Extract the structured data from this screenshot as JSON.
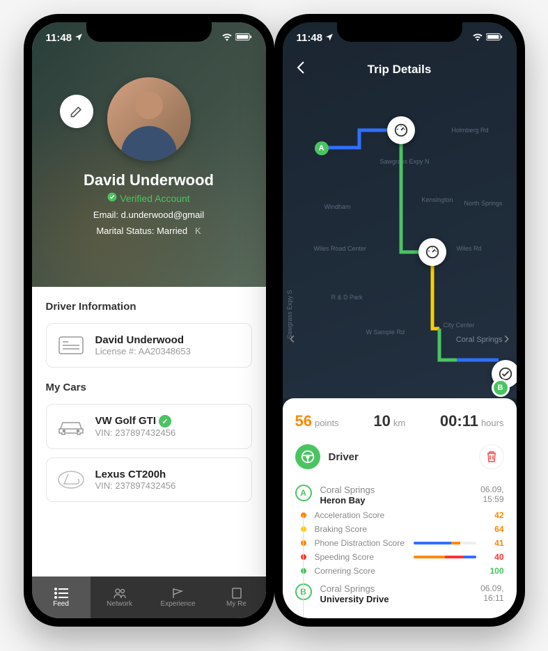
{
  "status": {
    "time": "11:48"
  },
  "phone1": {
    "profile": {
      "name": "David Underwood",
      "verified_label": "Verified Account",
      "email_label": "Email:",
      "email": "d.underwood@gmail",
      "marital_label": "Marital Status:",
      "marital": "Married"
    },
    "driver_info": {
      "section_title": "Driver Information",
      "name": "David Underwood",
      "license_label": "License #:",
      "license": "AA20348653"
    },
    "cars": {
      "section_title": "My Cars",
      "items": [
        {
          "name": "VW Golf GTI",
          "vin_label": "VIN:",
          "vin": "237897432456",
          "verified": true
        },
        {
          "name": "Lexus CT200h",
          "vin_label": "VIN:",
          "vin": "237897432456",
          "verified": false
        }
      ]
    },
    "nav": {
      "items": [
        {
          "label": "Feed"
        },
        {
          "label": "Network"
        },
        {
          "label": "Experience"
        },
        {
          "label": "My Re"
        }
      ]
    }
  },
  "phone2": {
    "title": "Trip Details",
    "stats": {
      "points_val": "56",
      "points_unit": "points",
      "dist_val": "10",
      "dist_unit": "km",
      "time_val": "00:11",
      "time_unit": "hours"
    },
    "driver_label": "Driver",
    "start": {
      "marker": "A",
      "city": "Coral Springs",
      "place": "Heron Bay",
      "date": "06.09,",
      "time": "15:59"
    },
    "end": {
      "marker": "B",
      "city": "Coral Springs",
      "place": "University Drive",
      "date": "06.09,",
      "time": "16:11"
    },
    "scores": [
      {
        "name": "Acceleration Score",
        "value": "42",
        "color": "#ff8800",
        "val_color": "#ff8800"
      },
      {
        "name": "Braking Score",
        "value": "64",
        "color": "#ffcc00",
        "val_color": "#ff8800"
      },
      {
        "name": "Phone Distraction Score",
        "value": "41",
        "color": "#ff8800",
        "val_color": "#ff8800",
        "bar": true
      },
      {
        "name": "Speeding Score",
        "value": "40",
        "color": "#ff3333",
        "val_color": "#ff3333",
        "bar": true
      },
      {
        "name": "Cornering Score",
        "value": "100",
        "color": "#4ac460",
        "val_color": "#4ac460"
      }
    ],
    "map_labels": [
      "Holmberg Rd",
      "Sawgrass Expy N",
      "Windham",
      "Kensington",
      "North Springs",
      "Wiles Road Center",
      "Wiles Rd",
      "R & D Park",
      "W Sample Rd",
      "City Center",
      "Coral Springs",
      "Sawgrass Expy S"
    ]
  }
}
